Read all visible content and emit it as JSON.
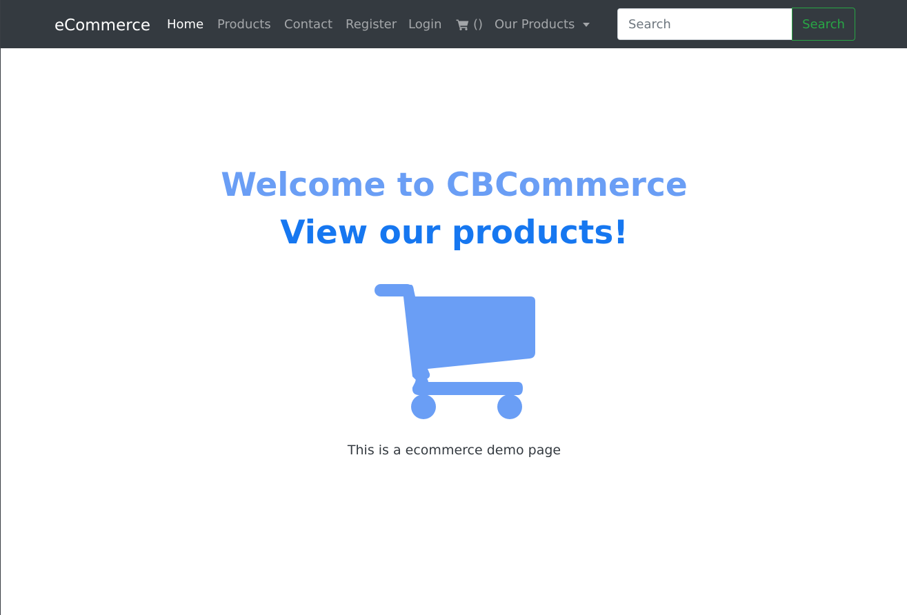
{
  "navbar": {
    "brand": "eCommerce",
    "links": {
      "home": "Home",
      "products": "Products",
      "contact": "Contact",
      "register": "Register",
      "login": "Login",
      "cart": "()",
      "our_products": "Our Products"
    },
    "active_link": "Home",
    "search": {
      "placeholder": "Search",
      "value": "",
      "button_label": "Search"
    },
    "colors": {
      "background": "#343a40",
      "search_button": "#28a745"
    },
    "icons": {
      "cart": "shopping-cart-icon",
      "dropdown": "caret-down-icon"
    }
  },
  "hero": {
    "title": "Welcome to CBCommerce",
    "subtitle": "View our products!",
    "icon": "shopping-cart-icon",
    "text": "This is a ecommerce demo page",
    "colors": {
      "title": "#6a9ef5",
      "subtitle": "#1677f0",
      "icon": "#6a9ef5"
    }
  }
}
